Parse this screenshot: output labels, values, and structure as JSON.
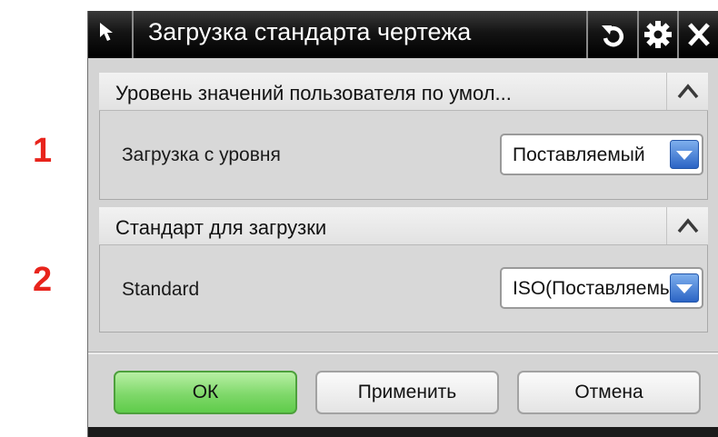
{
  "callouts": {
    "first": "1",
    "second": "2"
  },
  "window": {
    "title": "Загрузка стандарта чертежа"
  },
  "sections": [
    {
      "label": "Уровень значений пользователя по умол...",
      "field_label": "Загрузка с уровня",
      "field_value": "Поставляемый"
    },
    {
      "label": "Стандарт для загрузки",
      "field_label": "Standard",
      "field_value": "ISO(Поставляемый)"
    }
  ],
  "buttons": {
    "ok": "ОК",
    "apply": "Применить",
    "cancel": "Отмена"
  },
  "colors": {
    "ok_button": "#7fd86a",
    "callout": "#e8241c",
    "combo_arrow": "#2f6fd0",
    "titlebar": "#000000"
  }
}
